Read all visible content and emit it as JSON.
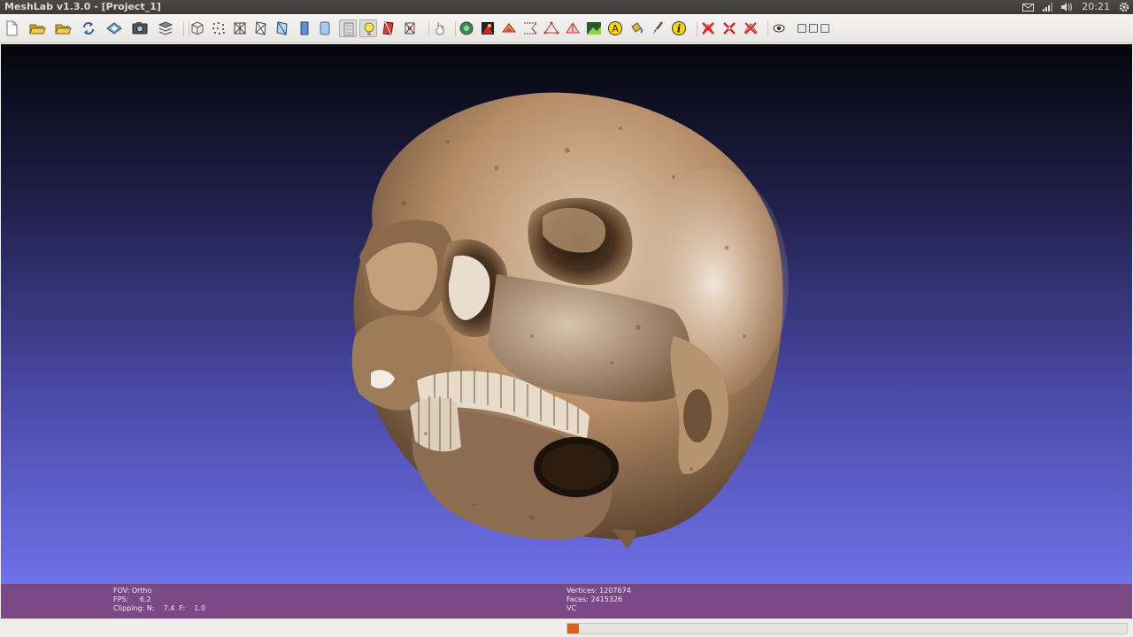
{
  "window": {
    "title": "MeshLab v1.3.0 - [Project_1]"
  },
  "tray": {
    "time": "20:21",
    "icons": [
      "mail-icon",
      "network-signal-icon",
      "volume-icon",
      "settings-gear-icon"
    ]
  },
  "toolbar": {
    "buttons": [
      {
        "name": "new-project-button",
        "icon": "blank-page-icon"
      },
      {
        "name": "open-project-button",
        "icon": "open-folder-icon"
      },
      {
        "name": "import-mesh-button",
        "icon": "open-folder-icon"
      },
      {
        "name": "reload-button",
        "icon": "reload-arrows-icon"
      },
      {
        "name": "export-mesh-button",
        "icon": "save-disk-icon"
      },
      {
        "name": "snapshot-button",
        "icon": "camera-icon"
      },
      {
        "name": "layers-button",
        "icon": "layers-icon"
      },
      {
        "name": "bbox-render-button",
        "icon": "bounding-box-icon"
      },
      {
        "name": "points-render-button",
        "icon": "points-icon"
      },
      {
        "name": "wireframe-render-button",
        "icon": "wireframe-icon"
      },
      {
        "name": "hidden-lines-render-button",
        "icon": "hidden-lines-icon"
      },
      {
        "name": "flat-lines-render-button",
        "icon": "flat-lines-icon"
      },
      {
        "name": "flat-render-button",
        "icon": "flat-shading-icon"
      },
      {
        "name": "smooth-render-button",
        "icon": "smooth-shading-icon"
      },
      {
        "name": "texture-render-button",
        "icon": "texture-icon"
      },
      {
        "name": "lighting-button",
        "icon": "light-bulb-icon"
      },
      {
        "name": "backface-button",
        "icon": "backface-icon"
      },
      {
        "name": "color-mode-button",
        "icon": "color-mode-icon"
      },
      {
        "name": "manipulator-button",
        "icon": "hand-cursor-icon"
      },
      {
        "name": "align-tool-button",
        "icon": "align-icon"
      },
      {
        "name": "paint-tool-button",
        "icon": "paint-icon"
      },
      {
        "name": "select-faces-button",
        "icon": "select-faces-icon"
      },
      {
        "name": "measure-tool-button",
        "icon": "measure-icon"
      },
      {
        "name": "pick-points-button",
        "icon": "pick-points-icon"
      },
      {
        "name": "select-vertices-button",
        "icon": "select-vertices-icon"
      },
      {
        "name": "raster-button",
        "icon": "raster-image-icon"
      },
      {
        "name": "annotate-button",
        "icon": "annotation-a-icon"
      },
      {
        "name": "paint-bucket-button",
        "icon": "paint-bucket-icon"
      },
      {
        "name": "brush-button",
        "icon": "brush-icon"
      },
      {
        "name": "info-button",
        "icon": "info-icon"
      },
      {
        "name": "delete-faces-button",
        "icon": "delete-faces-icon"
      },
      {
        "name": "delete-vertices-button",
        "icon": "delete-vertices-icon"
      },
      {
        "name": "delete-selection-button",
        "icon": "delete-selection-icon"
      },
      {
        "name": "view-options-button",
        "icon": "eye-icon"
      }
    ],
    "active": [
      "texture-render-button",
      "lighting-button"
    ]
  },
  "info_left": {
    "fov": "FOV: Ortho",
    "fps": "FPS:     6.2",
    "clipping": "Clipping: N:    7.4  F:    1.0"
  },
  "info_right": {
    "vertices": "Vertices: 1207674",
    "faces": "Faces: 2415326",
    "mode": "VC"
  },
  "colors": {
    "info_bar": "#7b4a86",
    "viewport_top": "#05050b",
    "viewport_bottom": "#7070e8",
    "progress_fill": "#e0601c"
  },
  "progress": {
    "fraction": 0.005
  }
}
